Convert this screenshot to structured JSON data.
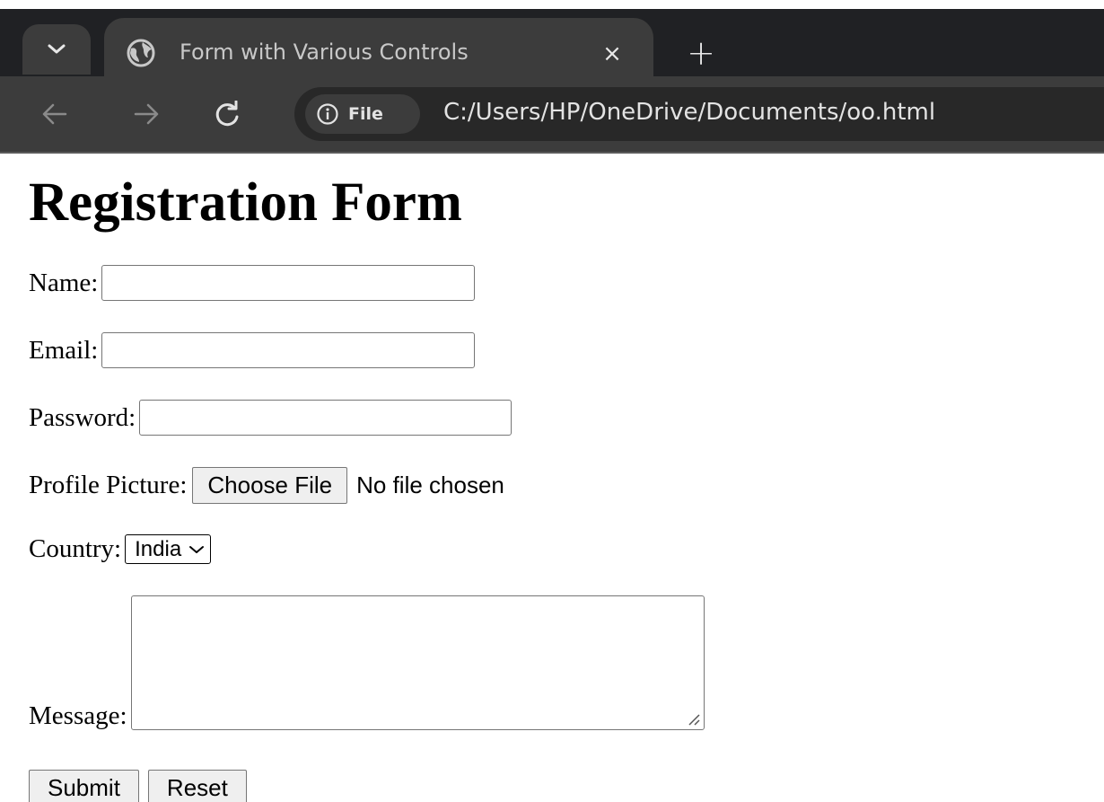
{
  "browser": {
    "tab_title": "Form with Various Controls",
    "tab_close_glyph": "×",
    "new_tab_glyph": "+",
    "site_chip_label": "File",
    "url": "C:/Users/HP/OneDrive/Documents/oo.html",
    "icons": [
      "chevron-down-icon",
      "globe-icon",
      "close-icon",
      "plus-icon",
      "back-arrow-icon",
      "forward-arrow-icon",
      "reload-icon",
      "info-icon"
    ]
  },
  "form": {
    "title": "Registration Form",
    "name_label": "Name:",
    "name_value": "",
    "email_label": "Email:",
    "email_value": "",
    "password_label": "Password:",
    "password_value": "",
    "picture_label": "Profile Picture:",
    "choose_file_label": "Choose File",
    "file_status": "No file chosen",
    "country_label": "Country:",
    "country_selected": "India",
    "message_label": "Message:",
    "message_value": "",
    "submit_label": "Submit",
    "reset_label": "Reset"
  },
  "colors": {
    "tabstrip_bg": "#202124",
    "toolbar_bg": "#3c3c3c",
    "omnibox_bg": "#282828",
    "page_bg": "#ffffff",
    "button_bg": "#efefef"
  }
}
